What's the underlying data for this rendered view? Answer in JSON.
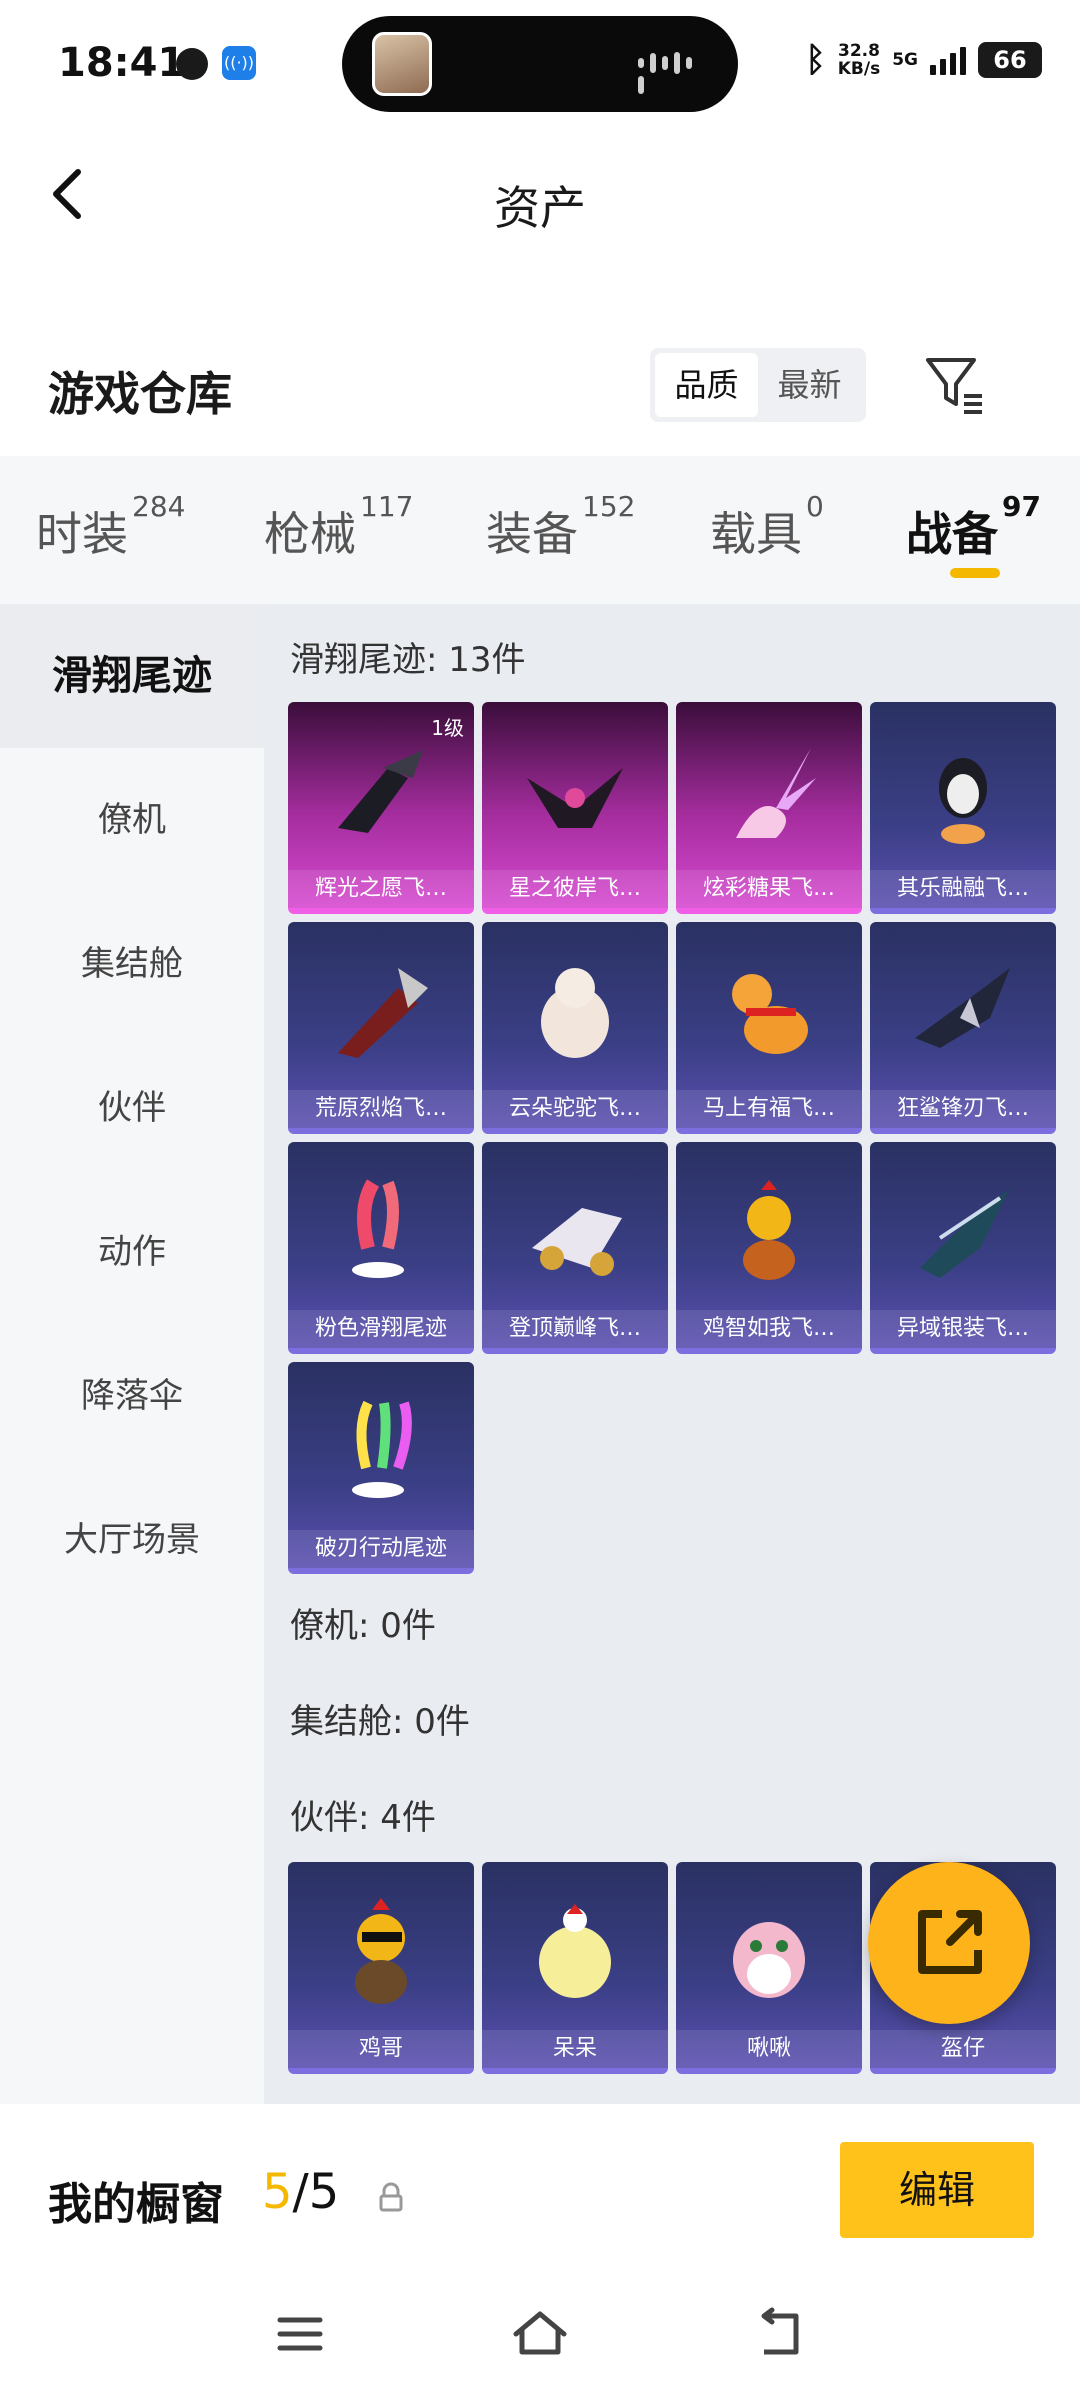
{
  "status_bar": {
    "time": "18:41",
    "speed_top": "32.8",
    "speed_unit": "KB/s",
    "network": "5G",
    "battery": "66",
    "icons": [
      "moon-icon",
      "nfc-icon",
      "bluetooth-icon",
      "signal-icon",
      "battery-icon"
    ]
  },
  "header": {
    "title": "资产"
  },
  "warehouse": {
    "title": "游戏仓库",
    "sort_options": [
      "品质",
      "最新"
    ],
    "sort_selected": "品质"
  },
  "tabs": [
    {
      "label": "时装",
      "count": "284"
    },
    {
      "label": "枪械",
      "count": "117"
    },
    {
      "label": "装备",
      "count": "152"
    },
    {
      "label": "载具",
      "count": "0"
    },
    {
      "label": "战备",
      "count": "97"
    }
  ],
  "active_tab": "战备",
  "sidebar": {
    "items": [
      {
        "label": "滑翔尾迹"
      },
      {
        "label": "僚机"
      },
      {
        "label": "集结舱"
      },
      {
        "label": "伙伴"
      },
      {
        "label": "动作"
      },
      {
        "label": "降落伞"
      },
      {
        "label": "大厅场景"
      }
    ],
    "active": "滑翔尾迹"
  },
  "sections": {
    "glide_title": "滑翔尾迹: 13件",
    "glide_items": [
      {
        "name": "辉光之愿飞…",
        "level": "1级",
        "rarity": "purple"
      },
      {
        "name": "星之彼岸飞…",
        "rarity": "purple"
      },
      {
        "name": "炫彩糖果飞…",
        "rarity": "purple"
      },
      {
        "name": "其乐融融飞…",
        "rarity": "blue"
      },
      {
        "name": "荒原烈焰飞…",
        "rarity": "blue"
      },
      {
        "name": "云朵驼驼飞…",
        "rarity": "blue"
      },
      {
        "name": "马上有福飞…",
        "rarity": "blue"
      },
      {
        "name": "狂鲨锋刃飞…",
        "rarity": "blue"
      },
      {
        "name": "粉色滑翔尾迹",
        "rarity": "blue"
      },
      {
        "name": "登顶巅峰飞…",
        "rarity": "blue"
      },
      {
        "name": "鸡智如我飞…",
        "rarity": "blue"
      },
      {
        "name": "异域银装飞…",
        "rarity": "blue"
      },
      {
        "name": "破刃行动尾迹",
        "rarity": "blue"
      }
    ],
    "wingman_title": "僚机: 0件",
    "pod_title": "集结舱: 0件",
    "partner_title": "伙伴: 4件",
    "partner_items": [
      {
        "name": "鸡哥"
      },
      {
        "name": "呆呆"
      },
      {
        "name": "啾啾"
      },
      {
        "name": "盔仔"
      }
    ]
  },
  "showcase": {
    "label": "我的橱窗",
    "current": "5",
    "total": "/5",
    "edit_label": "编辑"
  },
  "colors": {
    "accent": "#f5b800",
    "edit_button": "#ffc21a",
    "purple_card": "#c73bc3",
    "blue_card": "#3b3f86"
  }
}
